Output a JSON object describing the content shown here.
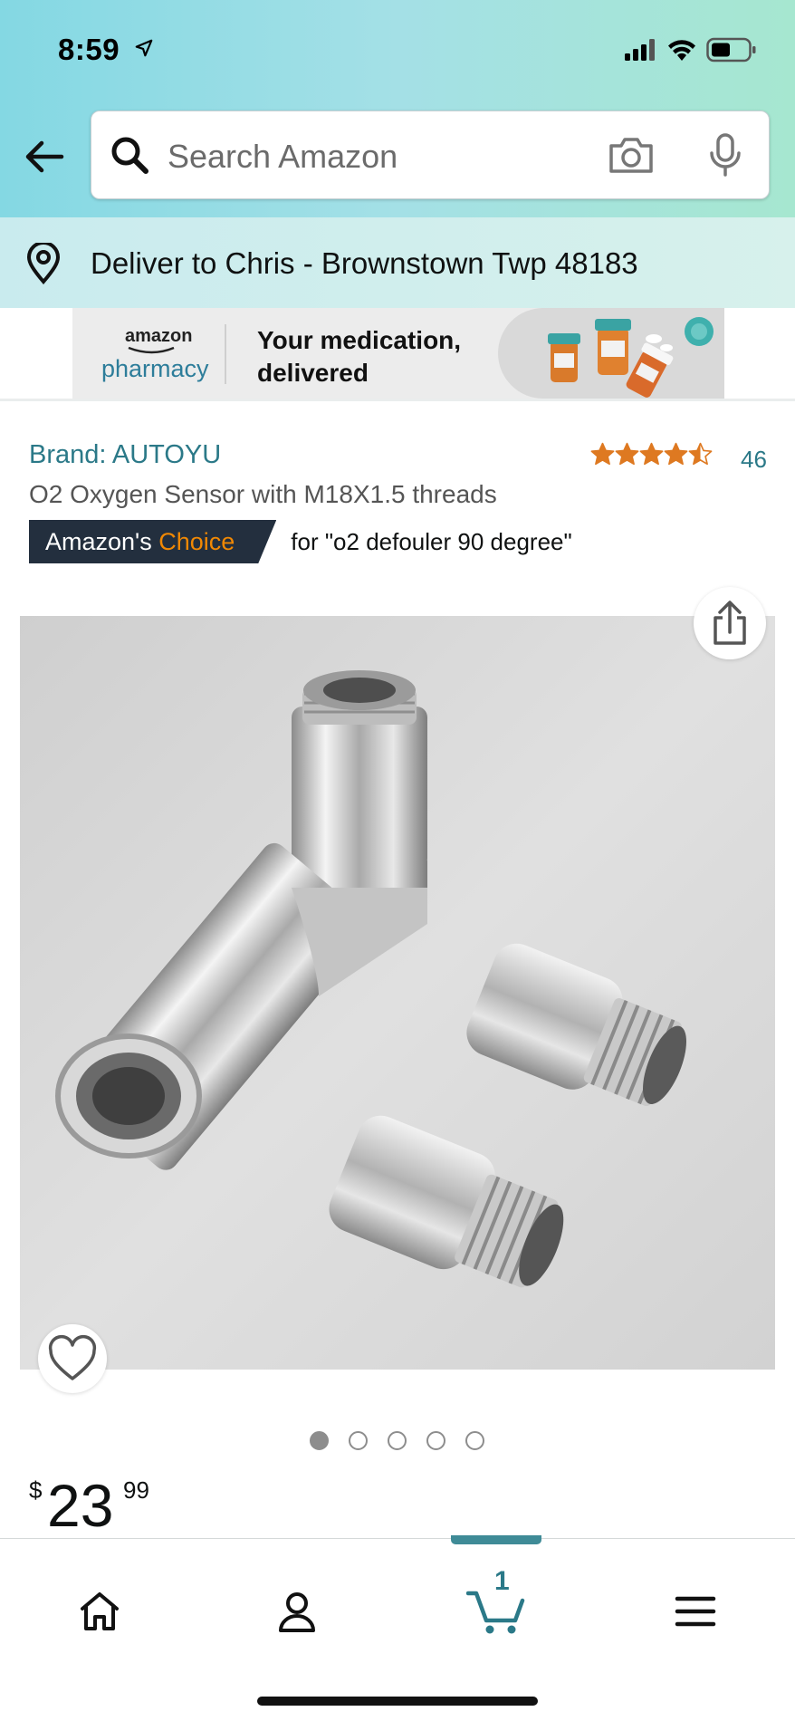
{
  "status_bar": {
    "time": "8:59"
  },
  "search": {
    "placeholder": "Search Amazon"
  },
  "delivery": {
    "text": "Deliver to Chris - Brownstown Twp 48183"
  },
  "banner": {
    "logo_amazon": "amazon",
    "logo_pharmacy": "pharmacy",
    "message": "Your medication, delivered"
  },
  "product": {
    "brand": "Brand: AUTOYU",
    "title": "O2 Oxygen Sensor with M18X1.5 threads",
    "rating": 4.5,
    "rating_max": 5,
    "rating_count": "46",
    "choice_badge_prefix": "Amazon's ",
    "choice_badge_accent": "Choice",
    "choice_for": "for \"o2 defouler 90 degree\"",
    "image_count": 5,
    "active_image_index": 0,
    "price_symbol": "$",
    "price_whole": "23",
    "price_fraction": "99"
  },
  "bottom_nav": {
    "items": [
      "home-icon",
      "account-icon",
      "cart-icon",
      "menu-icon"
    ],
    "cart_count": "1",
    "active": "cart"
  },
  "colors": {
    "header_gradient_start": "#84d8e3",
    "header_gradient_end": "#a6e7d0",
    "link_teal": "#2b7988",
    "star_orange": "#de7921",
    "choice_dark": "#232f3e",
    "choice_accent": "#f08804"
  }
}
